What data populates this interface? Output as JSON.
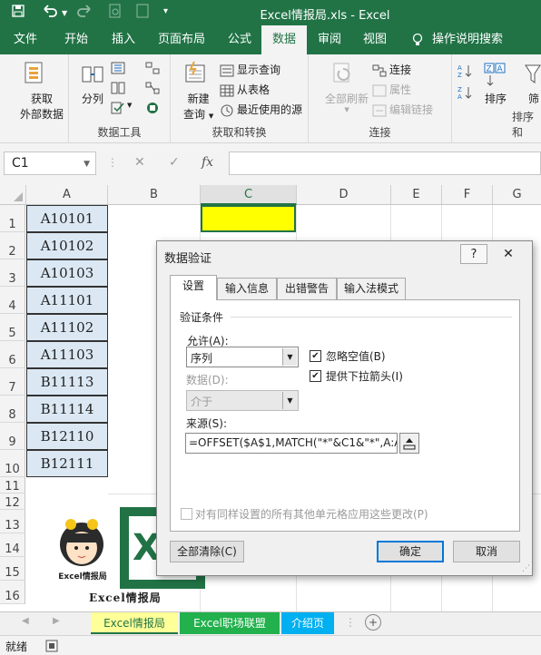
{
  "app": {
    "title": "Excel情报局.xls - Excel",
    "accent": "#217346"
  },
  "quick_access": [
    "save-icon",
    "undo-icon",
    "redo-icon",
    "print-preview-icon",
    "touch-mode-icon",
    "customize-icon"
  ],
  "tabs": [
    {
      "label": "文件"
    },
    {
      "label": "开始"
    },
    {
      "label": "插入"
    },
    {
      "label": "页面布局"
    },
    {
      "label": "公式"
    },
    {
      "label": "数据",
      "active": true
    },
    {
      "label": "审阅"
    },
    {
      "label": "视图"
    },
    {
      "label": "操作说明搜索"
    }
  ],
  "ribbon": {
    "get_external": {
      "label1": "获取",
      "label2": "外部数据"
    },
    "data_tools": {
      "split": "分列",
      "group_label": "数据工具"
    },
    "get_transform": {
      "new_query_1": "新建",
      "new_query_2": "查询",
      "show_query": "显示查询",
      "from_table": "从表格",
      "recent_sources": "最近使用的源",
      "group_label": "获取和转换"
    },
    "connections": {
      "refresh_all_1": "全部刷新",
      "connections": "连接",
      "properties": "属性",
      "edit_links": "编辑链接",
      "group_label": "连接"
    },
    "sort_filter": {
      "sort": "排序",
      "filter": "筛",
      "group_label": "排序和"
    }
  },
  "formula_bar": {
    "name_box": "C1",
    "cancel": "✕",
    "enter": "✓",
    "fx": "fx",
    "formula": ""
  },
  "grid": {
    "columns": [
      "A",
      "B",
      "C",
      "D",
      "E",
      "F",
      "G"
    ],
    "rows": [
      "1",
      "2",
      "3",
      "4",
      "5",
      "6",
      "7",
      "8",
      "9",
      "10",
      "11",
      "12",
      "13",
      "14",
      "15",
      "16"
    ],
    "column_a_values": [
      "A10101",
      "A10102",
      "A10103",
      "A11101",
      "A11102",
      "A11103",
      "B11113",
      "B11114",
      "B12110",
      "B12111"
    ],
    "logo_text": "Excel情报局",
    "logo_caption": "Excel情报局"
  },
  "dialog": {
    "title": "数据验证",
    "help": "?",
    "close": "✕",
    "tabs": [
      "设置",
      "输入信息",
      "出错警告",
      "输入法模式"
    ],
    "criteria_label": "验证条件",
    "allow_label": "允许(A):",
    "allow_value": "序列",
    "ignore_blank": "忽略空值(B)",
    "dropdown": "提供下拉箭头(I)",
    "data_label": "数据(D):",
    "data_value": "介于",
    "source_label": "来源(S):",
    "source_value": "=OFFSET($A$1,MATCH(\"*\"&C1&\"*\",A:A,",
    "apply_all": "对有同样设置的所有其他单元格应用这些更改(P)",
    "clear_all": "全部清除(C)",
    "ok": "确定",
    "cancel": "取消"
  },
  "sheets": [
    {
      "label": "Excel情报局",
      "color": "#ffff99",
      "active": true
    },
    {
      "label": "Excel职场联盟",
      "color": "#22b14c"
    },
    {
      "label": "介绍页",
      "color": "#00b0f0"
    }
  ],
  "status": {
    "text": "就绪"
  }
}
